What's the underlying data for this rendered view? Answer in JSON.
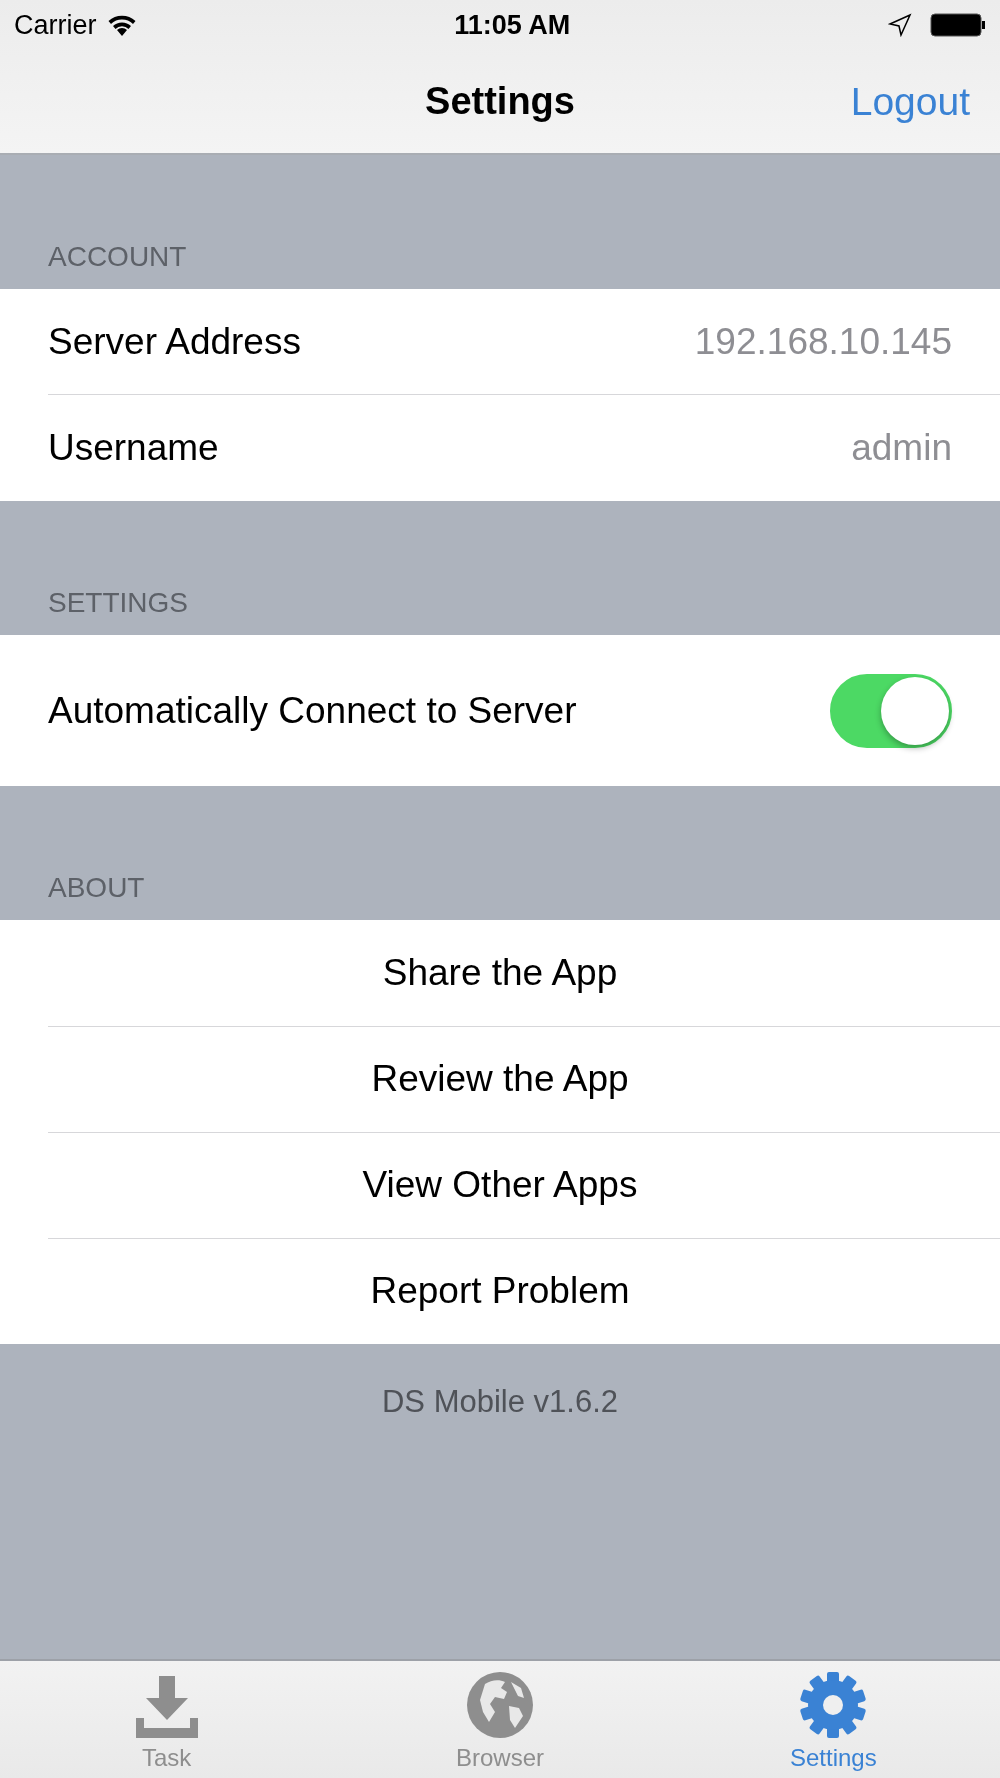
{
  "status_bar": {
    "carrier": "Carrier",
    "time": "11:05 AM"
  },
  "nav": {
    "title": "Settings",
    "action": "Logout"
  },
  "sections": [
    {
      "header": "ACCOUNT",
      "rows": [
        {
          "kind": "value",
          "label": "Server Address",
          "value": "192.168.10.145"
        },
        {
          "kind": "value",
          "label": "Username",
          "value": "admin"
        }
      ]
    },
    {
      "header": "SETTINGS",
      "rows": [
        {
          "kind": "toggle",
          "label": "Automatically Connect to Server",
          "on": true
        }
      ]
    },
    {
      "header": "ABOUT",
      "rows": [
        {
          "kind": "action",
          "label": "Share the App"
        },
        {
          "kind": "action",
          "label": "Review the App"
        },
        {
          "kind": "action",
          "label": "View Other Apps"
        },
        {
          "kind": "action",
          "label": "Report Problem"
        }
      ]
    }
  ],
  "footer": "DS Mobile v1.6.2",
  "tabs": [
    {
      "kind": "task",
      "label": "Task",
      "selected": false
    },
    {
      "kind": "browser",
      "label": "Browser",
      "selected": false
    },
    {
      "kind": "settings",
      "label": "Settings",
      "selected": true
    }
  ]
}
